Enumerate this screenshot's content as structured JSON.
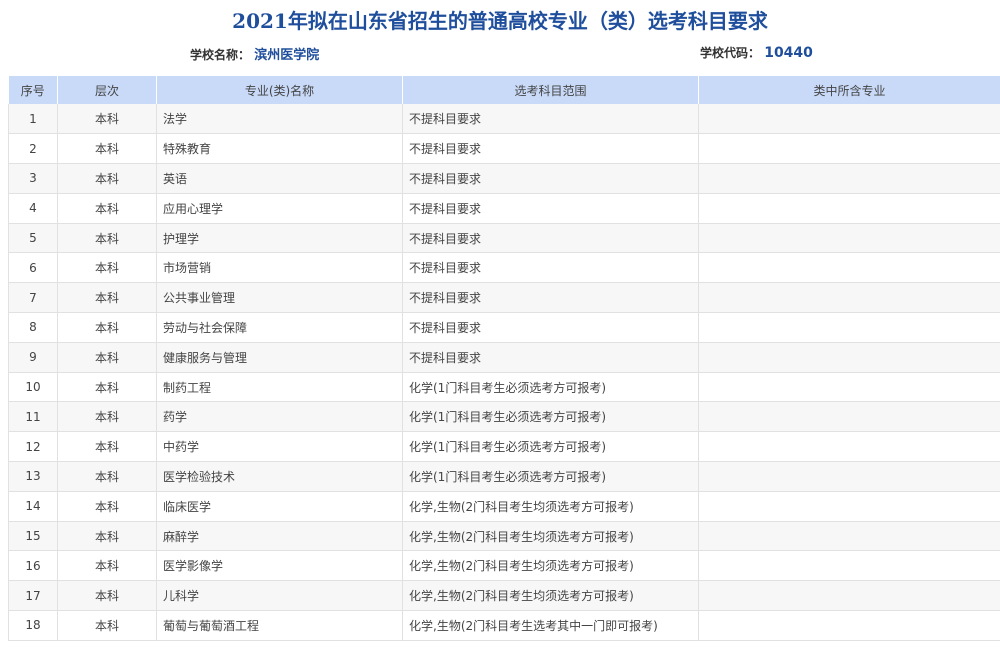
{
  "title": "2021年拟在山东省招生的普通高校专业（类）选考科目要求",
  "school": {
    "label": "学校名称：",
    "name": "滨州医学院"
  },
  "code": {
    "label": "学校代码：",
    "value": "10440"
  },
  "table": {
    "headers": [
      "序号",
      "层次",
      "专业(类)名称",
      "选考科目范围",
      "类中所含专业"
    ],
    "rows": [
      {
        "no": "1",
        "level": "本科",
        "major": "法学",
        "req": "不提科目要求",
        "sub": ""
      },
      {
        "no": "2",
        "level": "本科",
        "major": "特殊教育",
        "req": "不提科目要求",
        "sub": ""
      },
      {
        "no": "3",
        "level": "本科",
        "major": "英语",
        "req": "不提科目要求",
        "sub": ""
      },
      {
        "no": "4",
        "level": "本科",
        "major": "应用心理学",
        "req": "不提科目要求",
        "sub": ""
      },
      {
        "no": "5",
        "level": "本科",
        "major": "护理学",
        "req": "不提科目要求",
        "sub": ""
      },
      {
        "no": "6",
        "level": "本科",
        "major": "市场营销",
        "req": "不提科目要求",
        "sub": ""
      },
      {
        "no": "7",
        "level": "本科",
        "major": "公共事业管理",
        "req": "不提科目要求",
        "sub": ""
      },
      {
        "no": "8",
        "level": "本科",
        "major": "劳动与社会保障",
        "req": "不提科目要求",
        "sub": ""
      },
      {
        "no": "9",
        "level": "本科",
        "major": "健康服务与管理",
        "req": "不提科目要求",
        "sub": ""
      },
      {
        "no": "10",
        "level": "本科",
        "major": "制药工程",
        "req": "化学(1门科目考生必须选考方可报考)",
        "sub": ""
      },
      {
        "no": "11",
        "level": "本科",
        "major": "药学",
        "req": "化学(1门科目考生必须选考方可报考)",
        "sub": ""
      },
      {
        "no": "12",
        "level": "本科",
        "major": "中药学",
        "req": "化学(1门科目考生必须选考方可报考)",
        "sub": ""
      },
      {
        "no": "13",
        "level": "本科",
        "major": "医学检验技术",
        "req": "化学(1门科目考生必须选考方可报考)",
        "sub": ""
      },
      {
        "no": "14",
        "level": "本科",
        "major": "临床医学",
        "req": "化学,生物(2门科目考生均须选考方可报考)",
        "sub": ""
      },
      {
        "no": "15",
        "level": "本科",
        "major": "麻醉学",
        "req": "化学,生物(2门科目考生均须选考方可报考)",
        "sub": ""
      },
      {
        "no": "16",
        "level": "本科",
        "major": "医学影像学",
        "req": "化学,生物(2门科目考生均须选考方可报考)",
        "sub": ""
      },
      {
        "no": "17",
        "level": "本科",
        "major": "儿科学",
        "req": "化学,生物(2门科目考生均须选考方可报考)",
        "sub": ""
      },
      {
        "no": "18",
        "level": "本科",
        "major": "葡萄与葡萄酒工程",
        "req": "化学,生物(2门科目考生选考其中一门即可报考)",
        "sub": ""
      }
    ]
  }
}
